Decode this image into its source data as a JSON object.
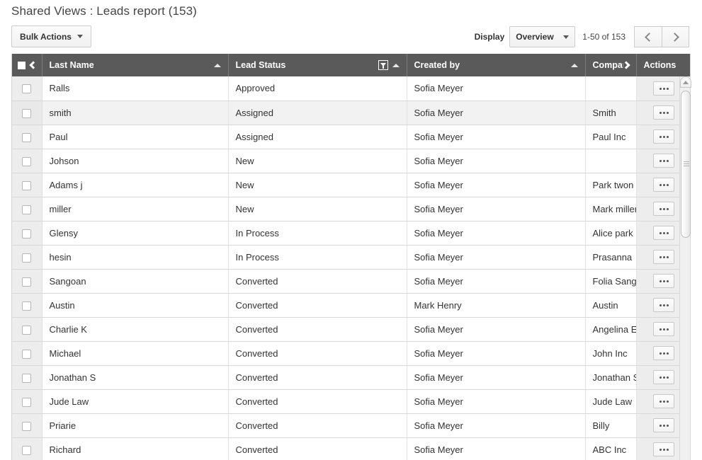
{
  "header": {
    "title": "Shared Views : Leads report (153)"
  },
  "toolbar": {
    "bulk_actions_label": "Bulk Actions",
    "display_label": "Display",
    "display_selected": "Overview",
    "display_options": [
      "Overview"
    ],
    "range_text": "1-50 of 153",
    "prev_icon": "chevron-left-icon",
    "next_icon": "chevron-right-icon"
  },
  "table": {
    "columns": [
      {
        "key": "check",
        "label": "",
        "sortable": false
      },
      {
        "key": "last_name",
        "label": "Last Name",
        "sort": "asc"
      },
      {
        "key": "lead_status",
        "label": "Lead Status",
        "sort": "asc",
        "filtered": true
      },
      {
        "key": "created_by",
        "label": "Created by",
        "sort": "asc"
      },
      {
        "key": "company",
        "label": "Company",
        "sort": false
      },
      {
        "key": "actions",
        "label": "Actions",
        "sort": false
      }
    ],
    "header_prev_icon": "chevron-left-icon",
    "header_next_icon": "chevron-right-icon",
    "row_action_icon": "ellipsis-icon",
    "rows": [
      {
        "last_name": "Ralls",
        "lead_status": "Approved",
        "created_by": "Sofia Meyer",
        "company": "",
        "highlighted": false
      },
      {
        "last_name": "smith",
        "lead_status": "Assigned",
        "created_by": "Sofia Meyer",
        "company": "Smith",
        "highlighted": true
      },
      {
        "last_name": "Paul",
        "lead_status": "Assigned",
        "created_by": "Sofia Meyer",
        "company": "Paul Inc",
        "highlighted": false
      },
      {
        "last_name": "Johson",
        "lead_status": "New",
        "created_by": "Sofia Meyer",
        "company": "",
        "highlighted": false
      },
      {
        "last_name": "Adams j",
        "lead_status": "New",
        "created_by": "Sofia Meyer",
        "company": "Park twon inc",
        "highlighted": false
      },
      {
        "last_name": "miller",
        "lead_status": "New",
        "created_by": "Sofia Meyer",
        "company": "Mark miller",
        "highlighted": false
      },
      {
        "last_name": "Glensy",
        "lead_status": "In Process",
        "created_by": "Sofia Meyer",
        "company": "Alice park ltd",
        "highlighted": false
      },
      {
        "last_name": "hesin",
        "lead_status": "In Process",
        "created_by": "Sofia Meyer",
        "company": "Prasanna",
        "highlighted": false
      },
      {
        "last_name": "Sangoan",
        "lead_status": "Converted",
        "created_by": "Sofia Meyer",
        "company": "Folia Sangoan",
        "highlighted": false
      },
      {
        "last_name": "Austin",
        "lead_status": "Converted",
        "created_by": "Mark Henry",
        "company": "Austin",
        "highlighted": false
      },
      {
        "last_name": "Charlie K",
        "lead_status": "Converted",
        "created_by": "Sofia Meyer",
        "company": "Angelina Exp",
        "highlighted": false
      },
      {
        "last_name": "Michael",
        "lead_status": "Converted",
        "created_by": "Sofia Meyer",
        "company": "John Inc",
        "highlighted": false
      },
      {
        "last_name": "Jonathan S",
        "lead_status": "Converted",
        "created_by": "Sofia Meyer",
        "company": "Jonathan S",
        "highlighted": false
      },
      {
        "last_name": "Jude Law",
        "lead_status": "Converted",
        "created_by": "Sofia Meyer",
        "company": "Jude Law",
        "highlighted": false
      },
      {
        "last_name": "Priarie",
        "lead_status": "Converted",
        "created_by": "Sofia Meyer",
        "company": "Billy",
        "highlighted": false
      },
      {
        "last_name": "Richard",
        "lead_status": "Converted",
        "created_by": "Sofia Meyer",
        "company": "ABC Inc",
        "highlighted": false
      }
    ]
  },
  "scrollbar": {
    "up_icon": "scroll-up-arrow-icon",
    "thumb_grip_icon": "scroll-thumb-grip-icon"
  },
  "colors": {
    "header_bg": "#5a5a5a",
    "title_text": "#444444",
    "row_highlight": "#f2f2f2",
    "gutter_bg": "#ededed"
  }
}
